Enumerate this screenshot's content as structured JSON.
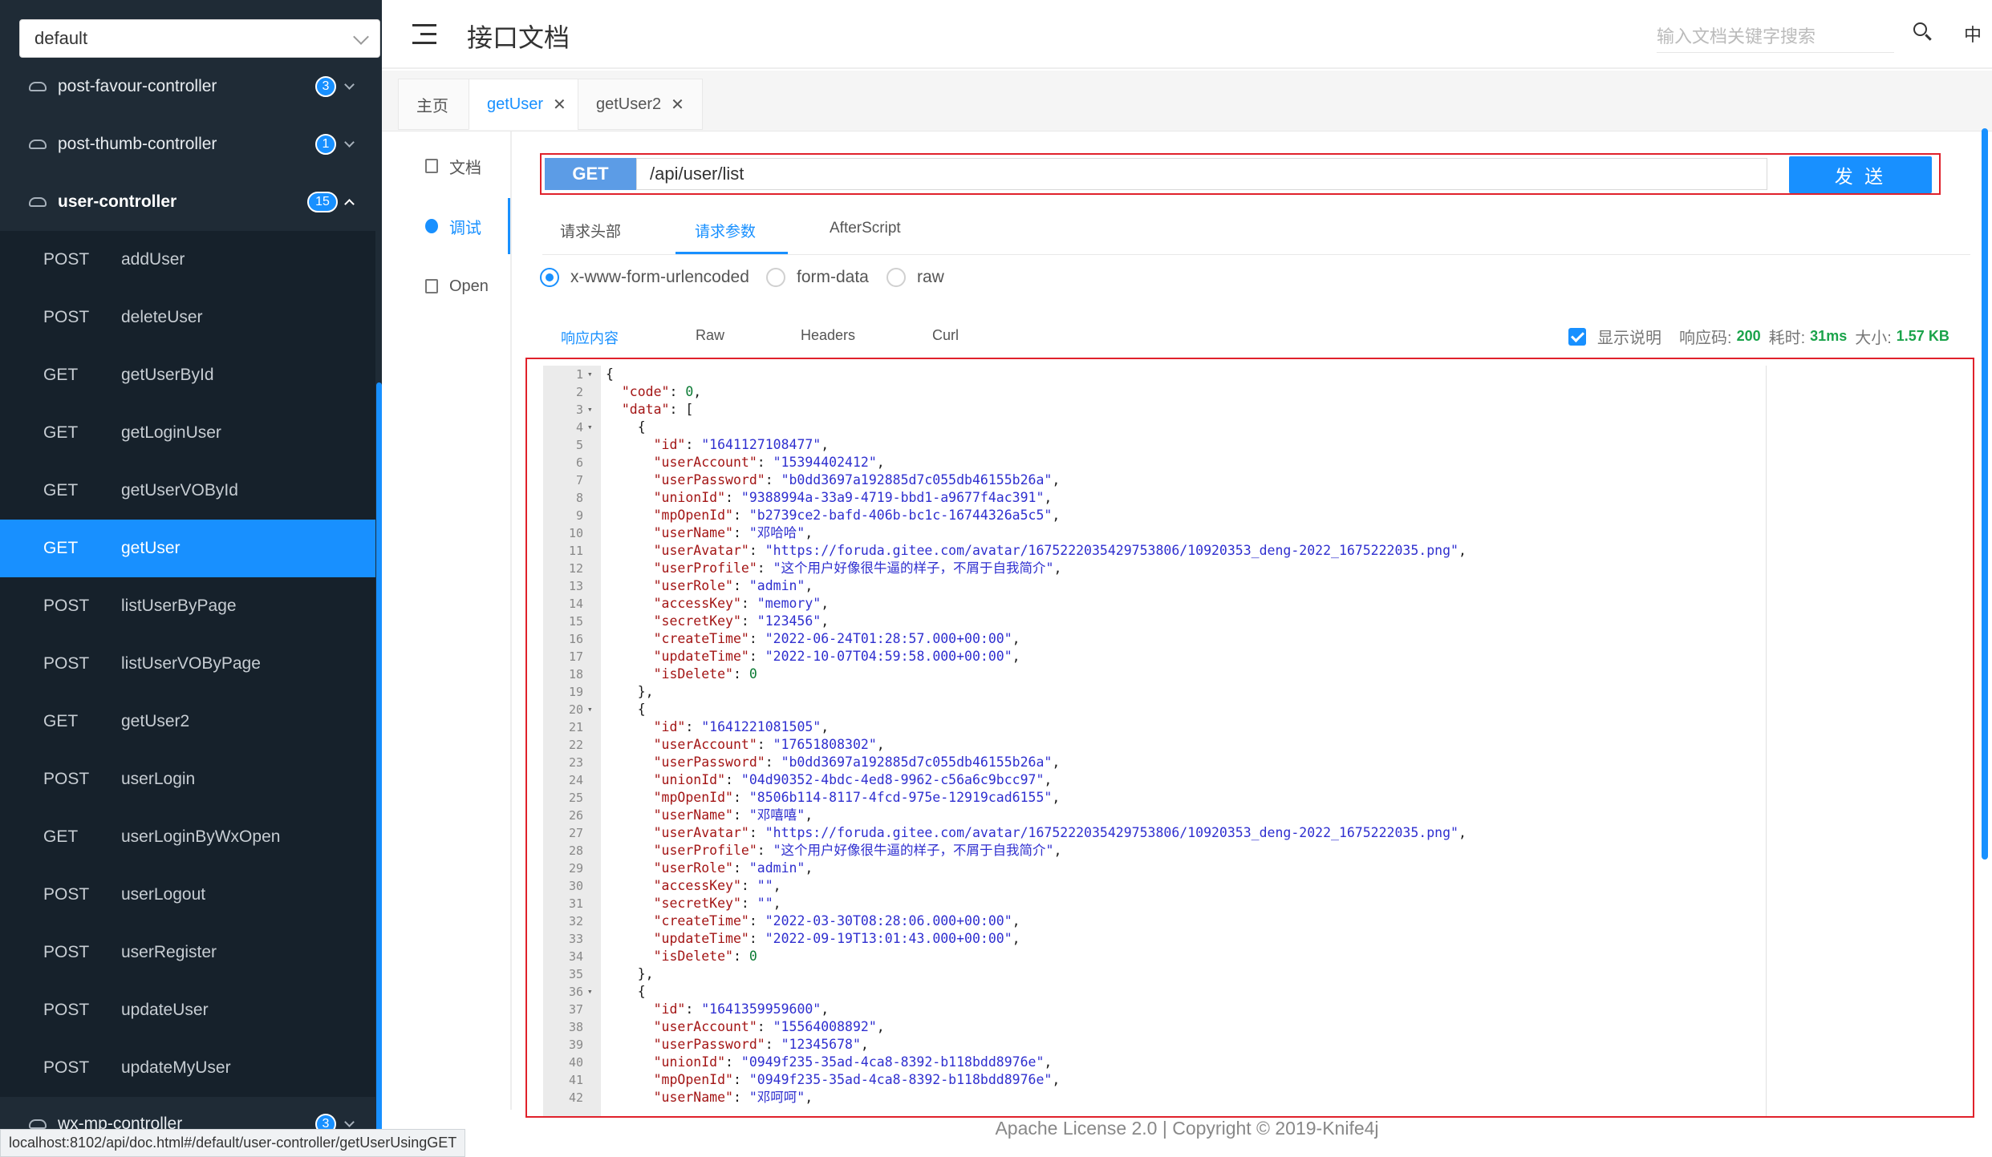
{
  "sidebar": {
    "group": "default",
    "controllers": [
      {
        "name": "post-favour-controller",
        "count": "3",
        "expanded": false
      },
      {
        "name": "post-thumb-controller",
        "count": "1",
        "expanded": false
      },
      {
        "name": "user-controller",
        "count": "15",
        "expanded": true
      },
      {
        "name": "wx-mp-controller",
        "count": "3",
        "expanded": false
      }
    ],
    "apis": [
      {
        "method": "POST",
        "path": "addUser"
      },
      {
        "method": "POST",
        "path": "deleteUser"
      },
      {
        "method": "GET",
        "path": "getUserById"
      },
      {
        "method": "GET",
        "path": "getLoginUser"
      },
      {
        "method": "GET",
        "path": "getUserVOById"
      },
      {
        "method": "GET",
        "path": "getUser",
        "selected": true
      },
      {
        "method": "POST",
        "path": "listUserByPage"
      },
      {
        "method": "POST",
        "path": "listUserVOByPage"
      },
      {
        "method": "GET",
        "path": "getUser2"
      },
      {
        "method": "POST",
        "path": "userLogin"
      },
      {
        "method": "GET",
        "path": "userLoginByWxOpen"
      },
      {
        "method": "POST",
        "path": "userLogout"
      },
      {
        "method": "POST",
        "path": "userRegister"
      },
      {
        "method": "POST",
        "path": "updateUser"
      },
      {
        "method": "POST",
        "path": "updateMyUser"
      }
    ]
  },
  "status_url": "localhost:8102/api/doc.html#/default/user-controller/getUserUsingGET",
  "header": {
    "title": "接口文档",
    "search_placeholder": "输入文档关键字搜索",
    "lang": "中"
  },
  "tabs": [
    {
      "label": "主页",
      "closable": false
    },
    {
      "label": "getUser",
      "closable": true,
      "active": true
    },
    {
      "label": "getUser2",
      "closable": true
    }
  ],
  "subnav": [
    {
      "label": "文档",
      "icon": "document-icon"
    },
    {
      "label": "调试",
      "icon": "debug-icon",
      "active": true
    },
    {
      "label": "Open",
      "icon": "file-icon"
    }
  ],
  "request": {
    "method": "GET",
    "url": "/api/user/list",
    "send_label": "发 送"
  },
  "param_tabs": [
    "请求头部",
    "请求参数",
    "AfterScript"
  ],
  "param_tab_active": 1,
  "content_types": [
    "x-www-form-urlencoded",
    "form-data",
    "raw"
  ],
  "content_type_selected": 0,
  "response_tabs": [
    "响应内容",
    "Raw",
    "Headers",
    "Curl"
  ],
  "response_tab_active": 0,
  "response_meta": {
    "show_desc_label": "显示说明",
    "code_label": "响应码:",
    "code": "200",
    "time_label": "耗时:",
    "time": "31ms",
    "size_label": "大小:",
    "size": "1.57 KB"
  },
  "code_lines": [
    "{",
    "  \"code\": 0,",
    "  \"data\": [",
    "    {",
    "      \"id\": \"1641127108477\",",
    "      \"userAccount\": \"15394402412\",",
    "      \"userPassword\": \"b0dd3697a192885d7c055db46155b26a\",",
    "      \"unionId\": \"9388994a-33a9-4719-bbd1-a9677f4ac391\",",
    "      \"mpOpenId\": \"b2739ce2-bafd-406b-bc1c-16744326a5c5\",",
    "      \"userName\": \"邓哈哈\",",
    "      \"userAvatar\": \"https://foruda.gitee.com/avatar/1675222035429753806/10920353_deng-2022_1675222035.png\",",
    "      \"userProfile\": \"这个用户好像很牛逼的样子，不屑于自我简介\",",
    "      \"userRole\": \"admin\",",
    "      \"accessKey\": \"memory\",",
    "      \"secretKey\": \"123456\",",
    "      \"createTime\": \"2022-06-24T01:28:57.000+00:00\",",
    "      \"updateTime\": \"2022-10-07T04:59:58.000+00:00\",",
    "      \"isDelete\": 0",
    "    },",
    "    {",
    "      \"id\": \"1641221081505\",",
    "      \"userAccount\": \"17651808302\",",
    "      \"userPassword\": \"b0dd3697a192885d7c055db46155b26a\",",
    "      \"unionId\": \"04d90352-4bdc-4ed8-9962-c56a6c9bcc97\",",
    "      \"mpOpenId\": \"8506b114-8117-4fcd-975e-12919cad6155\",",
    "      \"userName\": \"邓嘻嘻\",",
    "      \"userAvatar\": \"https://foruda.gitee.com/avatar/1675222035429753806/10920353_deng-2022_1675222035.png\",",
    "      \"userProfile\": \"这个用户好像很牛逼的样子，不屑于自我简介\",",
    "      \"userRole\": \"admin\",",
    "      \"accessKey\": \"\",",
    "      \"secretKey\": \"\",",
    "      \"createTime\": \"2022-03-30T08:28:06.000+00:00\",",
    "      \"updateTime\": \"2022-09-19T13:01:43.000+00:00\",",
    "      \"isDelete\": 0",
    "    },",
    "    {",
    "      \"id\": \"1641359959600\",",
    "      \"userAccount\": \"15564008892\",",
    "      \"userPassword\": \"12345678\",",
    "      \"unionId\": \"0949f235-35ad-4ca8-8392-b118bdd8976e\",",
    "      \"mpOpenId\": \"0949f235-35ad-4ca8-8392-b118bdd8976e\",",
    "      \"userName\": \"邓呵呵\","
  ],
  "fold_lines": [
    1,
    3,
    4,
    20,
    36
  ],
  "footer": "Apache License 2.0 | Copyright © 2019-Knife4j",
  "colors": {
    "accent": "#1890ff",
    "sidebar_bg": "#1f2b36",
    "highlight_border": "#e0212b",
    "success": "#1aa34a"
  }
}
